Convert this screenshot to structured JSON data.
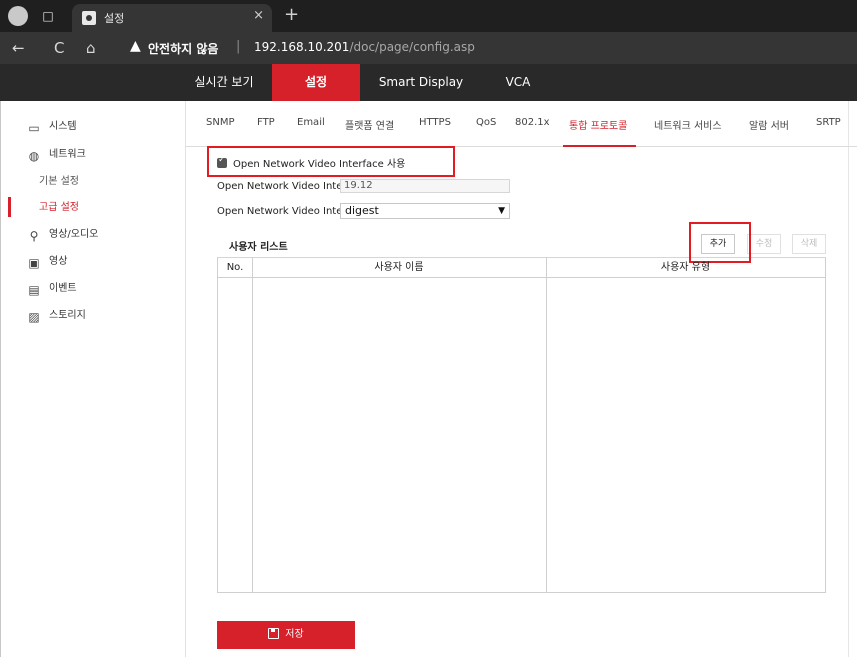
{
  "browser": {
    "tab_toggle_icon": "□",
    "tab_title": "설정",
    "tab_close": "×",
    "new_tab": "+",
    "back": "←",
    "reload": "C",
    "home": "⌂",
    "warning_icon": "▲",
    "security_label": "안전하지 않음",
    "separator": "|",
    "url_host": "192.168.10.201",
    "url_path": "/doc/page/config.asp"
  },
  "appnav": {
    "items": [
      {
        "label": "실시간 보기",
        "active": false
      },
      {
        "label": "설정",
        "active": true
      },
      {
        "label": "Smart Display",
        "active": false
      },
      {
        "label": "VCA",
        "active": false
      }
    ]
  },
  "sidebar": {
    "items": [
      {
        "label": "시스템",
        "icon": "monitor-icon"
      },
      {
        "label": "네트워크",
        "icon": "globe-icon"
      },
      {
        "label": "기본 설정",
        "icon": ""
      },
      {
        "label": "고급 설정",
        "icon": ""
      },
      {
        "label": "영상/오디오",
        "icon": "camera-mic-icon"
      },
      {
        "label": "영상",
        "icon": "image-icon"
      },
      {
        "label": "이벤트",
        "icon": "calendar-icon"
      },
      {
        "label": "스토리지",
        "icon": "storage-icon"
      }
    ]
  },
  "subtabs": [
    "SNMP",
    "FTP",
    "Email",
    "플랫폼 연결",
    "HTTPS",
    "QoS",
    "802.1x",
    "통합 프로토콜",
    "네트워크 서비스",
    "알람 서버",
    "SRTP"
  ],
  "form": {
    "enable_label": "Open Network Video Interface 사용",
    "enable_checked": true,
    "version_label": "Open Network Video Inter...",
    "version_value": "19.12",
    "auth_label": "Open Network Video Inter...",
    "auth_value": "digest"
  },
  "userlist": {
    "title": "사용자 리스트",
    "add_label": "추가",
    "edit_label": "수정",
    "delete_label": "삭제",
    "columns": [
      "No.",
      "사용자 이름",
      "사용자 유형"
    ],
    "rows": []
  },
  "save_label": "저장",
  "colors": {
    "accent": "#d6202a",
    "highlight_box": "#e31b23",
    "appnav_bg": "#292929"
  }
}
